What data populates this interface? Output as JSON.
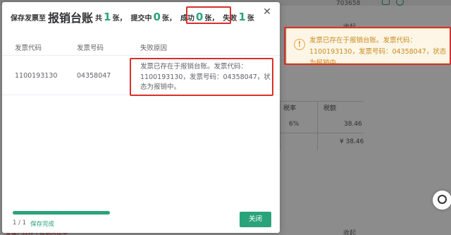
{
  "background": {
    "invoice_code_fragment": "703658",
    "collapse_label": "收起",
    "table_headers": [
      "税率",
      "税额"
    ],
    "tax_rate": "6%",
    "tax_amount": "38.46",
    "tax_total": "¥ 38.46",
    "red_note": "发票已存在于报销台账中"
  },
  "toast": {
    "icon": "warning-icon",
    "text": "发票已存在于报销台账。发票代码：1100193130，发票号码：04358047，状态为报销中。",
    "color": "#e6a23c"
  },
  "modal": {
    "title_prefix": "保存发票至",
    "title_target": "报销台账",
    "total_prefix": "共",
    "total_count": "1",
    "total_suffix": "张，",
    "submitting_prefix": "提交中",
    "submitting_count": "0",
    "submitting_suffix": "张，",
    "success_prefix": "成功",
    "success_count": "0",
    "success_suffix": "张，",
    "fail_prefix": "失败",
    "fail_count": "1",
    "fail_suffix": "张",
    "close_icon": "close-icon",
    "table": {
      "headers": [
        "发票代码",
        "发票号码",
        "失败原因"
      ],
      "rows": [
        {
          "code": "1100193130",
          "number": "04358047",
          "reason": "发票已存在于报销台账。发票代码：1100193130，发票号码：04358047，状态为报销中。"
        }
      ]
    },
    "progress": {
      "done": 1,
      "total": 1,
      "fraction": 1.0,
      "count_text": "1 / 1",
      "status": "保存完成"
    },
    "close_button_label": "关闭"
  },
  "colors": {
    "accent": "#2aa37a",
    "highlight": "#d9302a",
    "warning": "#e6a23c"
  }
}
